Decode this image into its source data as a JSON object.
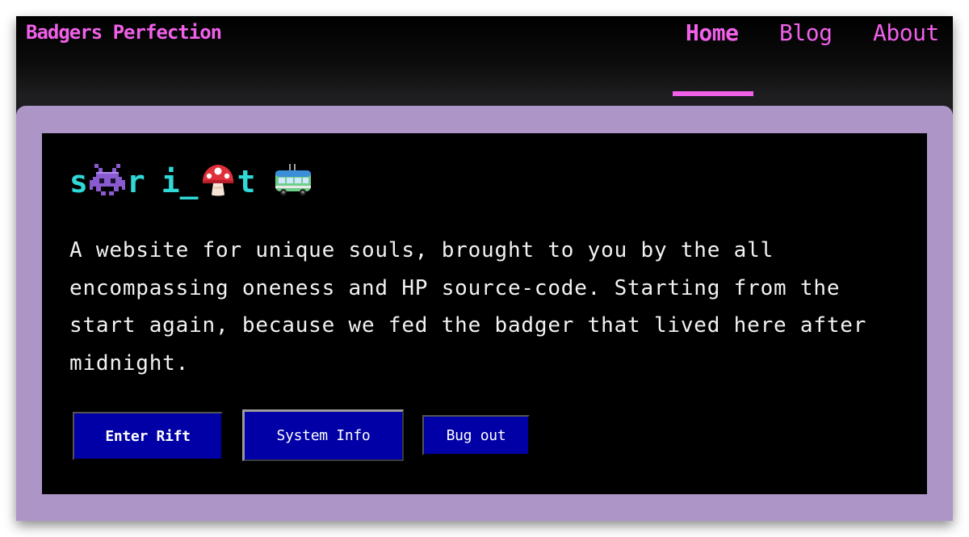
{
  "site": {
    "brand": "Badgers Perfection"
  },
  "nav": {
    "items": [
      {
        "label": "Home",
        "active": true
      },
      {
        "label": "Blog",
        "active": false
      },
      {
        "label": "About",
        "active": false
      }
    ]
  },
  "hero": {
    "title": {
      "letters": [
        "s",
        "r",
        "i",
        "_",
        "t"
      ],
      "icons": [
        "alien-monster-icon",
        "mushroom-icon",
        "trolleybus-icon"
      ]
    },
    "intro": "A website for unique souls, brought to you by the all encompassing oneness and HP source-code. Starting from the start again, because we fed the badger that lived here after midnight."
  },
  "buttons": {
    "enter": "Enter Rift",
    "system": "System Info",
    "bug": "Bug out"
  },
  "colors": {
    "accent": "#f060e8",
    "title": "#30d8d8",
    "card": "#ad96c7",
    "button": "#0000a6"
  }
}
